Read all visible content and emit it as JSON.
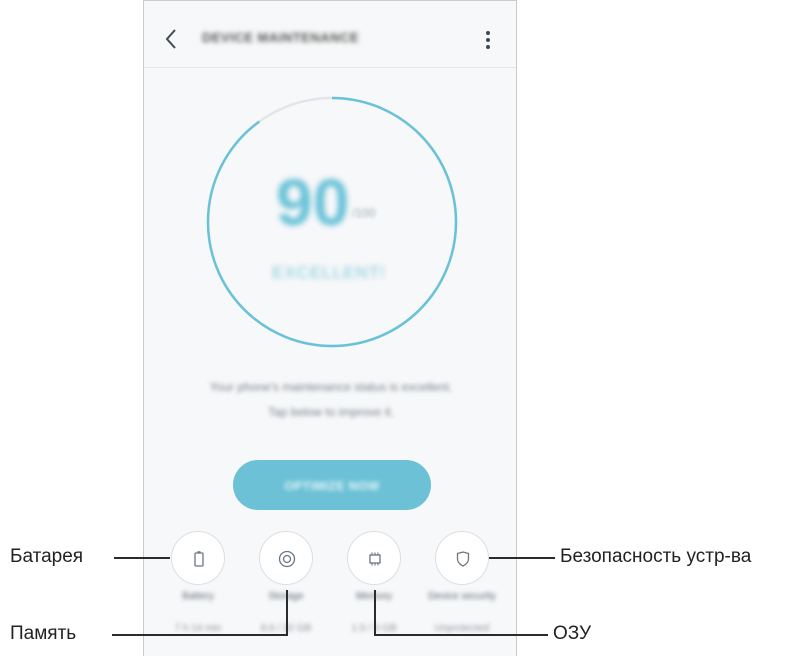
{
  "appbar": {
    "title": "DEVICE MAINTENANCE"
  },
  "gauge": {
    "score": "90",
    "score_fraction": 0.9,
    "score_unit": "/100",
    "status": "EXCELLENT!",
    "ring_color": "#6ac2d8",
    "track_color": "#e3e6e8"
  },
  "description": {
    "line1": "Your phone's maintenance status is excellent.",
    "line2": "Tap below to improve it."
  },
  "optimize_button": {
    "label": "OPTIMIZE NOW",
    "color": "#6cc1d6"
  },
  "categories": [
    {
      "label": "Battery",
      "value": "7 h 14 min",
      "icon": "battery-icon"
    },
    {
      "label": "Storage",
      "value": "8.6 / 32 GB",
      "icon": "storage-icon"
    },
    {
      "label": "Memory",
      "value": "1.5 / 3 GB",
      "icon": "memory-chip-icon"
    },
    {
      "label": "Device security",
      "value": "Unprotected",
      "icon": "shield-icon"
    }
  ],
  "callouts": {
    "battery": "Батарея",
    "storage": "Память",
    "memory": "ОЗУ",
    "security": "Безопасность устр-ва"
  }
}
